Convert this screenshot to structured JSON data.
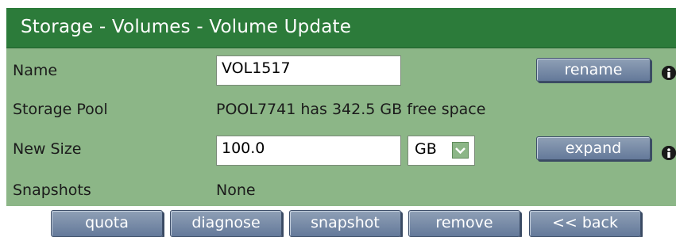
{
  "page": {
    "title": "Storage - Volumes - Volume Update"
  },
  "form": {
    "name": {
      "label": "Name",
      "value": "VOL1517",
      "button": "rename"
    },
    "pool": {
      "label": "Storage Pool",
      "value": "POOL7741 has 342.5 GB free space"
    },
    "size": {
      "label": "New Size",
      "value": "100.0",
      "unit": "GB",
      "button": "expand"
    },
    "snapshots": {
      "label": "Snapshots",
      "value": "None"
    }
  },
  "actions": {
    "quota": "quota",
    "diagnose": "diagnose",
    "snapshot": "snapshot",
    "remove": "remove",
    "back": "<< back"
  },
  "icons": {
    "info": "info-icon",
    "dropdown": "chevron-down-icon"
  },
  "colors": {
    "header": "#2c7b3a",
    "panel": "#8cb687",
    "button": "#7388a8"
  }
}
